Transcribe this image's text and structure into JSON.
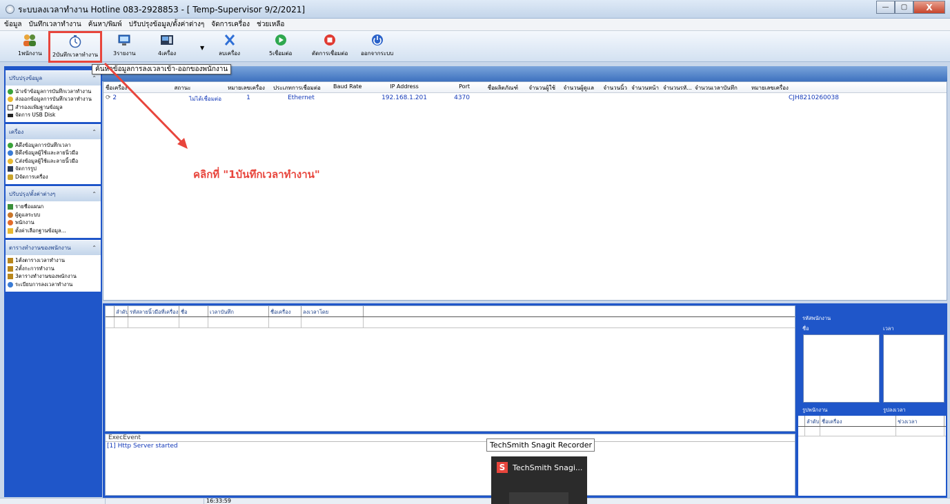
{
  "window": {
    "title": "ระบบลงเวลาทำงาน  Hotline 083-2928853 - [ Temp-Supervisor 9/2/2021]",
    "minimize": "—",
    "maximize": "▢",
    "close": "X"
  },
  "menu": [
    "ข้อมูล",
    "บันทึกเวลาทำงาน",
    "ค้นหา/พิมพ์",
    "ปรับปรุงข้อมูล/ตั้งค่าต่างๆ",
    "จัดการเครื่อง",
    "ช่วยเหลือ"
  ],
  "toolbar": {
    "buttons": [
      {
        "label": "1พนักงาน",
        "icon": "users-icon"
      },
      {
        "label": "2บันทึกเวลาทำงาน",
        "icon": "stopwatch-icon"
      },
      {
        "label": "3รายงาน",
        "icon": "monitor-report-icon"
      },
      {
        "label": "4เครื่อง",
        "icon": "device-icon"
      },
      {
        "label": "ลบเครื่อง",
        "icon": "delete-x-icon"
      },
      {
        "label": "5เชื่อมต่อ",
        "icon": "connect-play-icon"
      },
      {
        "label": "ตัดการเชื่อมต่อ",
        "icon": "disconnect-stop-icon"
      },
      {
        "label": "ออกจากระบบ",
        "icon": "power-icon"
      }
    ],
    "tooltip": "ค้นหาข้อมูลการลงเวลาเข้า-ออกของพนักงาน"
  },
  "sidebar": {
    "groups": [
      {
        "title": "ปรับปรุงข้อมูล",
        "items": [
          "นำเข้าข้อมูลการบันทึกเวลาทำงาน",
          "ส่งออกข้อมูลการบันทึกเวลาทำงาน",
          "สำรองแฟ้มฐานข้อมูล",
          "จัดการ USB Disk"
        ]
      },
      {
        "title": "เครื่อง",
        "items": [
          "Aดึงข้อมูลการบันทึกเวลา",
          "Bดึงข้อมูลผู้ใช้และลายนิ้วมือ",
          "Cส่งข้อมูลผู้ใช้และลายนิ้วมือ",
          "จัดการรูป",
          "Dจัดการเครื่อง"
        ]
      },
      {
        "title": "ปรับปรุง/ตั้งค่าต่างๆ",
        "items": [
          "รายชื่อแผนก",
          "ผู้ดูแลระบบ",
          "พนักงาน",
          "ตั้งค่าเลือกฐานข้อมูล..."
        ]
      },
      {
        "title": "ตารางทำงานของพนักงาน",
        "items": [
          "1ตั้งตารางเวลาทำงาน",
          "2ตั้งกะการทำงาน",
          "3ตารางทำงานของพนักงาน",
          "ระเบียบการลงเวลาทำงาน"
        ]
      }
    ]
  },
  "device_grid": {
    "columns": [
      "ชื่อเครื่อง",
      "สถานะ",
      "หมายเลขเครื่อง",
      "ประเภทการเชื่อมต่อ",
      "Baud Rate",
      "IP Address",
      "Port",
      "ชื่อผลิตภัณฑ์",
      "จำนวนผู้ใช้",
      "จำนวนผู้ดูแล",
      "จำนวนนิ้ว",
      "จำนวนหน้า",
      "จำนวนรหั...",
      "จำนวนเวลาบันทึก",
      "หมายเลขเครื่อง"
    ],
    "rows": [
      {
        "name": "2",
        "status": "ไม่ได้เชื่อมต่อ",
        "number": "1",
        "conn": "Ethernet",
        "baud": "",
        "ip": "192.168.1.201",
        "port": "4370",
        "serial": "CJH8210260038"
      }
    ]
  },
  "log_table": {
    "columns": [
      "ลำดับ",
      "รหัสลายนิ้วมือที่เครื่อง",
      "ชื่อ",
      "เวลาบันทึก",
      "ชื่อเครื่อง",
      "ลงเวลาโดย"
    ]
  },
  "exec": {
    "title": "ExecEvent",
    "lines": [
      "[1] Http Server started"
    ]
  },
  "right_panel": {
    "emp_code": "รหัสพนักงาน",
    "name": "ชื่อ",
    "time": "เวลา",
    "emp_photo": "รูปพนักงาน",
    "time_photo": "รูปลงเวลา",
    "columns": [
      "ลำดับ",
      "ชื่อเครื่อง",
      "ช่วงเวลา"
    ]
  },
  "status_bar": {
    "time": "16:33:59"
  },
  "annotation": {
    "text": "คลิกที่ \"1บันทึกเวลาทำงาน\"",
    "color": "#e8453c"
  },
  "snagit": {
    "tooltip": "TechSmith Snagit Recorder",
    "card_label": "TechSmith Snagi..."
  }
}
